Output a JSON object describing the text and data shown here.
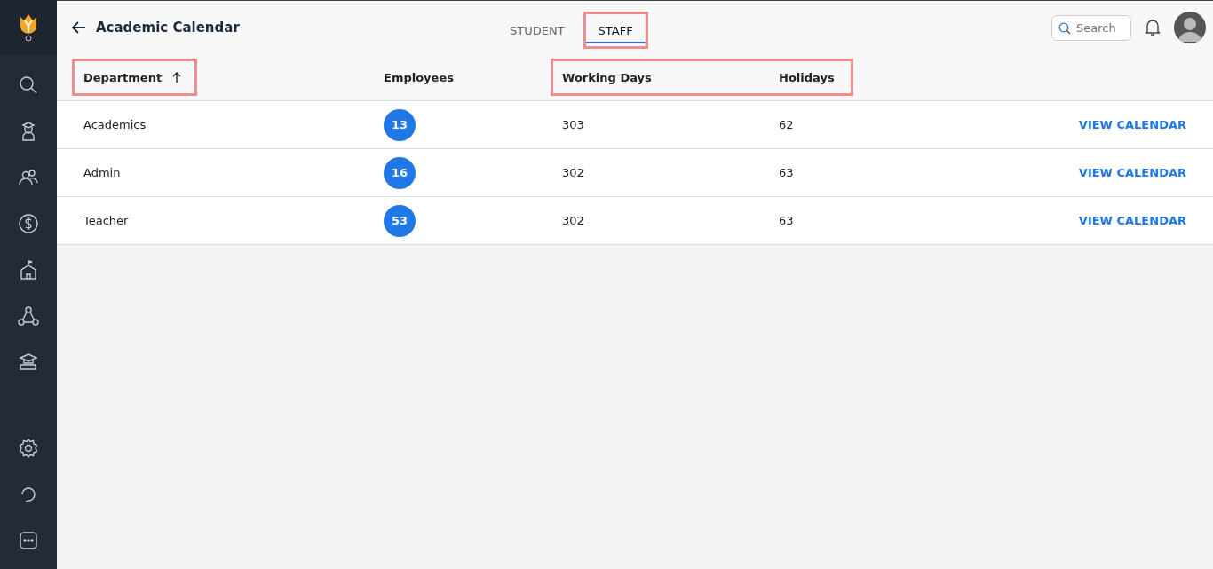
{
  "header": {
    "title": "Academic Calendar",
    "search": {
      "placeholder": "Search"
    }
  },
  "tabs": [
    {
      "label": "STUDENT",
      "selected": false,
      "highlighted": false
    },
    {
      "label": "STAFF",
      "selected": true,
      "highlighted": true
    }
  ],
  "table": {
    "columns": [
      {
        "label": "Department",
        "sorted": true,
        "highlighted": true
      },
      {
        "label": "Employees",
        "sorted": false,
        "highlighted": false
      },
      {
        "label": "Working Days",
        "sorted": false,
        "highlighted": true
      },
      {
        "label": "Holidays",
        "sorted": false,
        "highlighted": true
      }
    ],
    "rows": [
      {
        "department": "Academics",
        "employees": "13",
        "working_days": "303",
        "holidays": "62",
        "action": "VIEW CALENDAR"
      },
      {
        "department": "Admin",
        "employees": "16",
        "working_days": "302",
        "holidays": "63",
        "action": "VIEW CALENDAR"
      },
      {
        "department": "Teacher",
        "employees": "53",
        "working_days": "302",
        "holidays": "63",
        "action": "VIEW CALENDAR"
      }
    ]
  }
}
